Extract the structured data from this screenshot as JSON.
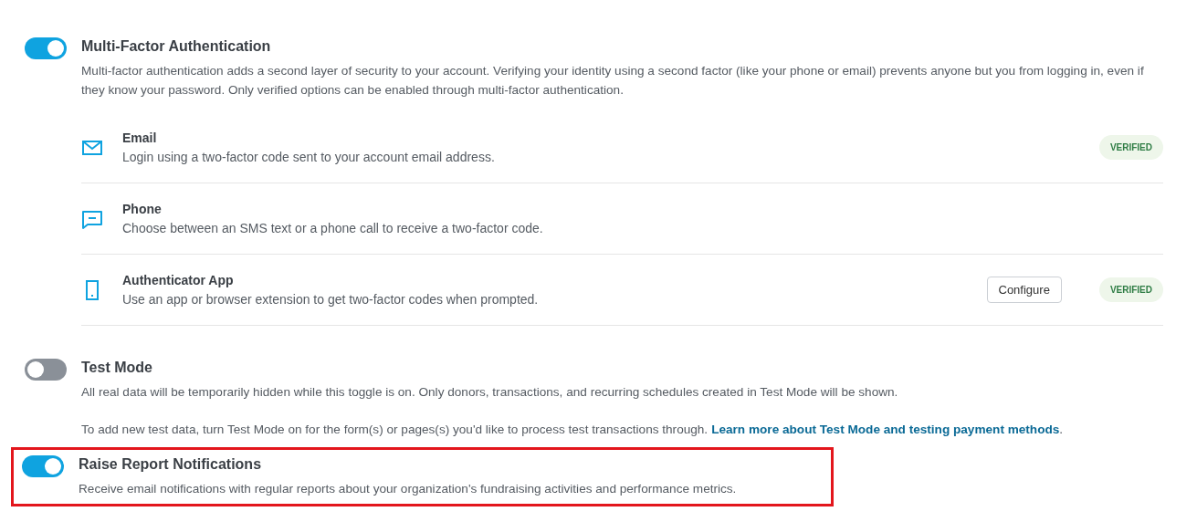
{
  "settings": [
    {
      "title": "Multi-Factor Authentication",
      "on": true,
      "highlighted": false,
      "paragraphs": [
        {
          "text": "Multi-factor authentication adds a second layer of security to your account. Verifying your identity using a second factor (like your phone or email) prevents anyone but you from logging in, even if they know your password. Only verified options can be enabled through multi-factor authentication."
        }
      ],
      "methods": [
        {
          "kind": "email",
          "title": "Email",
          "description": "Login using a two-factor code sent to your account email address.",
          "badge": "VERIFIED"
        },
        {
          "kind": "phone",
          "title": "Phone",
          "description": "Choose between an SMS text or a phone call to receive a two-factor code."
        },
        {
          "kind": "app",
          "title": "Authenticator App",
          "description": "Use an app or browser extension to get two-factor codes when prompted.",
          "button": "Configure",
          "badge": "VERIFIED"
        }
      ]
    },
    {
      "title": "Test Mode",
      "on": false,
      "highlighted": false,
      "paragraphs": [
        {
          "text": "All real data will be temporarily hidden while this toggle is on. Only donors, transactions, and recurring schedules created in Test Mode will be shown."
        },
        {
          "text": "To add new test data, turn Test Mode on for the form(s) or pages(s) you'd like to process test transactions through.",
          "link": "Learn more about Test Mode and testing payment methods",
          "after": "."
        }
      ]
    },
    {
      "title": "Raise Report Notifications",
      "on": true,
      "highlighted": true,
      "paragraphs": [
        {
          "text": "Receive email notifications with regular reports about your organization's fundraising activities and performance metrics."
        }
      ]
    }
  ]
}
